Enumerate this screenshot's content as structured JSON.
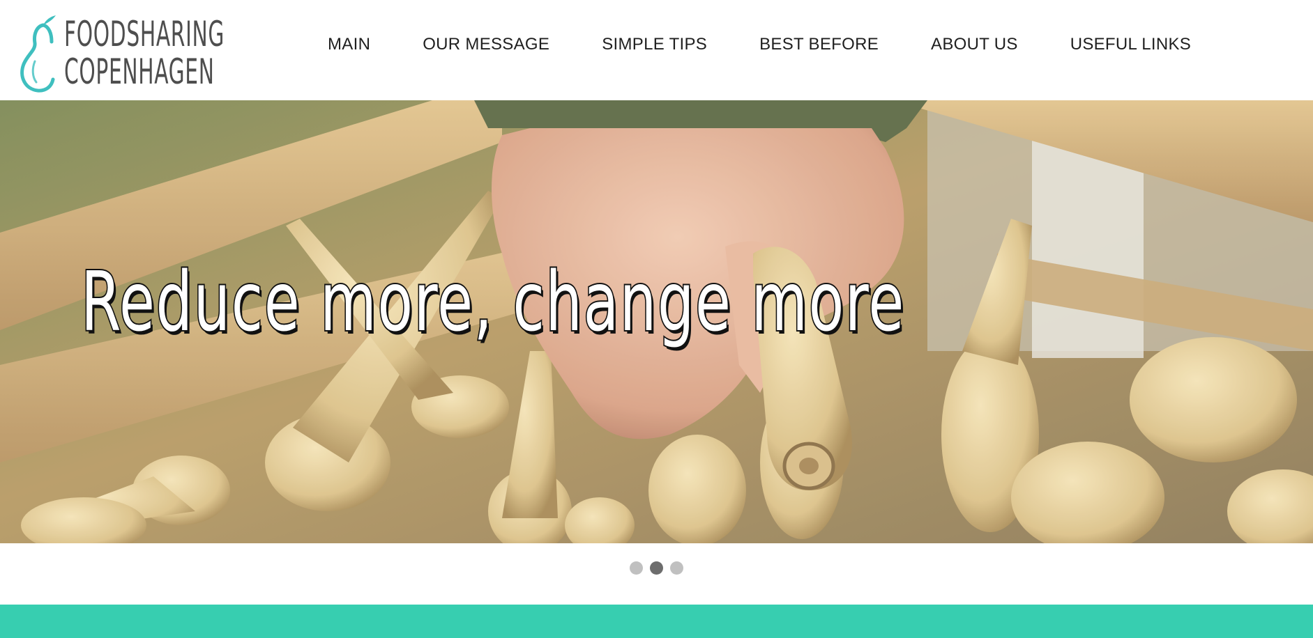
{
  "brand": {
    "line1": "FOODSHARING",
    "line2": "COPENHAGEN",
    "icon": "pear-icon",
    "icon_color": "#3fbfbf",
    "text_color": "#4e4e4e"
  },
  "nav": {
    "items": [
      {
        "label": "MAIN"
      },
      {
        "label": "OUR MESSAGE"
      },
      {
        "label": "SIMPLE TIPS"
      },
      {
        "label": "BEST BEFORE"
      },
      {
        "label": "ABOUT US"
      },
      {
        "label": "USEFUL LINKS"
      }
    ]
  },
  "hero": {
    "headline": "Reduce more, change more",
    "image": "parsnips-hand-photo"
  },
  "slider": {
    "dot_count": 3,
    "active_index": 1
  },
  "colors": {
    "accent": "#37ceb0",
    "dot_inactive": "#c0c0c0",
    "dot_active": "#6d6d6d"
  }
}
